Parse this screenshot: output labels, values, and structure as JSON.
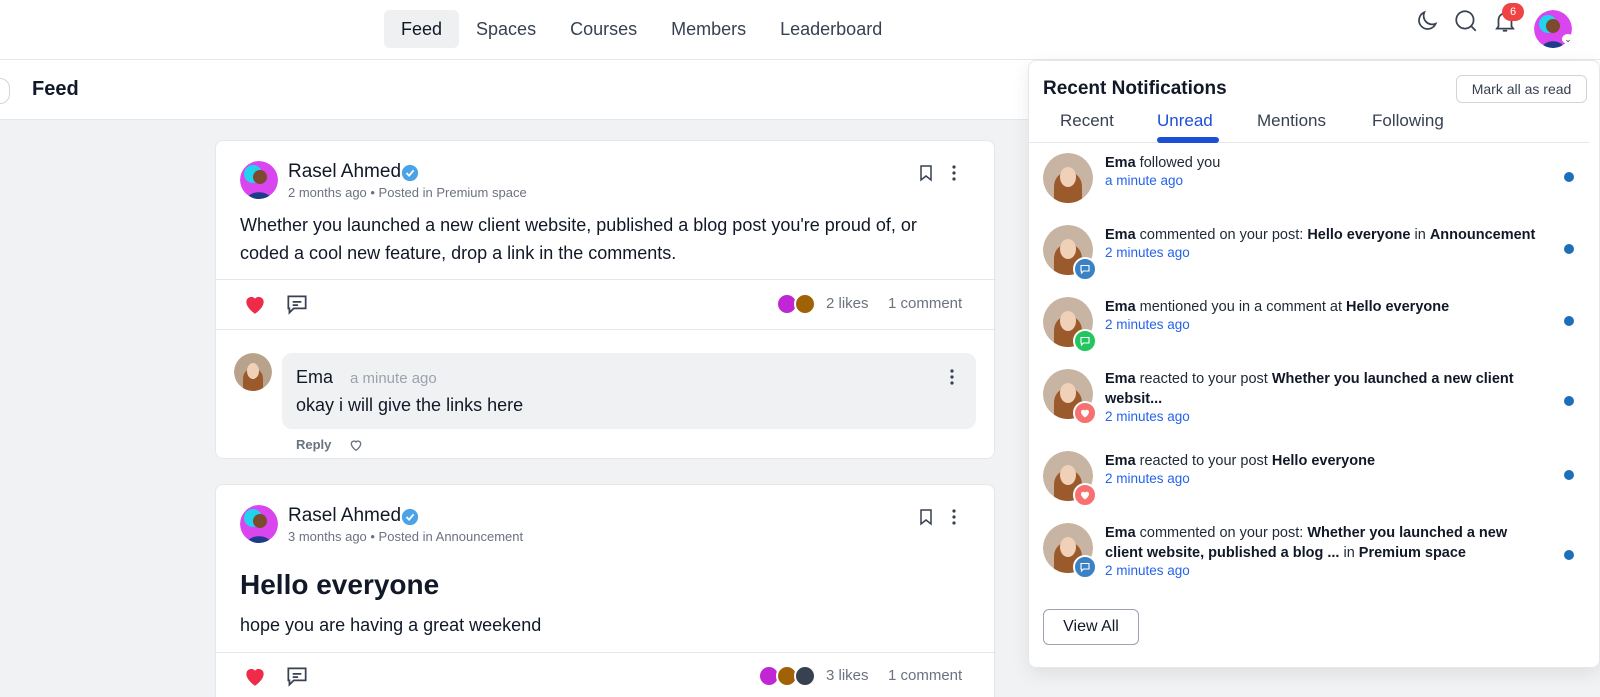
{
  "nav": {
    "items": [
      "Feed",
      "Spaces",
      "Courses",
      "Members",
      "Leaderboard"
    ],
    "active": "Feed",
    "notification_badge": "6"
  },
  "subheader": {
    "title": "Feed"
  },
  "posts": [
    {
      "author": "Rasel Ahmed",
      "meta": "2 months ago • Posted in Premium space",
      "body": "Whether you launched a new client website, published a blog post you're proud of, or coded a cool new feature, drop a link in the comments.",
      "likes": "2 likes",
      "comments": "1 comment",
      "comment": {
        "name": "Ema",
        "time": "a minute ago",
        "text": "okay i will give the links here",
        "reply_label": "Reply"
      }
    },
    {
      "author": "Rasel Ahmed",
      "meta": "3 months ago • Posted in Announcement",
      "title": "Hello everyone",
      "body": "hope you are having a great weekend",
      "likes": "3 likes",
      "comments": "1 comment"
    }
  ],
  "notifications": {
    "title": "Recent Notifications",
    "mark_all": "Mark all as read",
    "tabs": [
      "Recent",
      "Unread",
      "Mentions",
      "Following"
    ],
    "active_tab": "Unread",
    "items": [
      {
        "actor": "Ema",
        "text_parts": [
          [
            "b",
            "Ema"
          ],
          [
            "t",
            " followed you"
          ]
        ],
        "time": "a minute ago",
        "icon": "none"
      },
      {
        "actor": "Ema",
        "text_parts": [
          [
            "b",
            "Ema"
          ],
          [
            "t",
            " commented on your post: "
          ],
          [
            "b",
            "Hello everyone"
          ],
          [
            "t",
            " in "
          ],
          [
            "b",
            "Announcement"
          ]
        ],
        "time": "2 minutes ago",
        "icon": "comment-icon"
      },
      {
        "actor": "Ema",
        "text_parts": [
          [
            "b",
            "Ema"
          ],
          [
            "t",
            " mentioned you in a comment at "
          ],
          [
            "b",
            "Hello everyone"
          ]
        ],
        "time": "2 minutes ago",
        "icon": "mention-icon"
      },
      {
        "actor": "Ema",
        "text_parts": [
          [
            "b",
            "Ema"
          ],
          [
            "t",
            " reacted to your post "
          ],
          [
            "b",
            "Whether you launched a new client websit..."
          ]
        ],
        "time": "2 minutes ago",
        "icon": "heart-icon"
      },
      {
        "actor": "Ema",
        "text_parts": [
          [
            "b",
            "Ema"
          ],
          [
            "t",
            " reacted to your post "
          ],
          [
            "b",
            "Hello everyone"
          ]
        ],
        "time": "2 minutes ago",
        "icon": "heart-icon"
      },
      {
        "actor": "Ema",
        "text_parts": [
          [
            "b",
            "Ema"
          ],
          [
            "t",
            " commented on your post: "
          ],
          [
            "b",
            "Whether you launched a new client website, published a blog ..."
          ],
          [
            "t",
            " in "
          ],
          [
            "b",
            "Premium space"
          ]
        ],
        "time": "2 minutes ago",
        "icon": "comment-icon"
      }
    ],
    "view_all": "View All"
  },
  "colors": {
    "accent": "#1d4ed8",
    "badge": "#ef4444",
    "heart": "#ef2b4a",
    "comment_badge": "#3b82c4",
    "mention_badge": "#22c55e",
    "unread_dot": "#1d6fb8"
  }
}
